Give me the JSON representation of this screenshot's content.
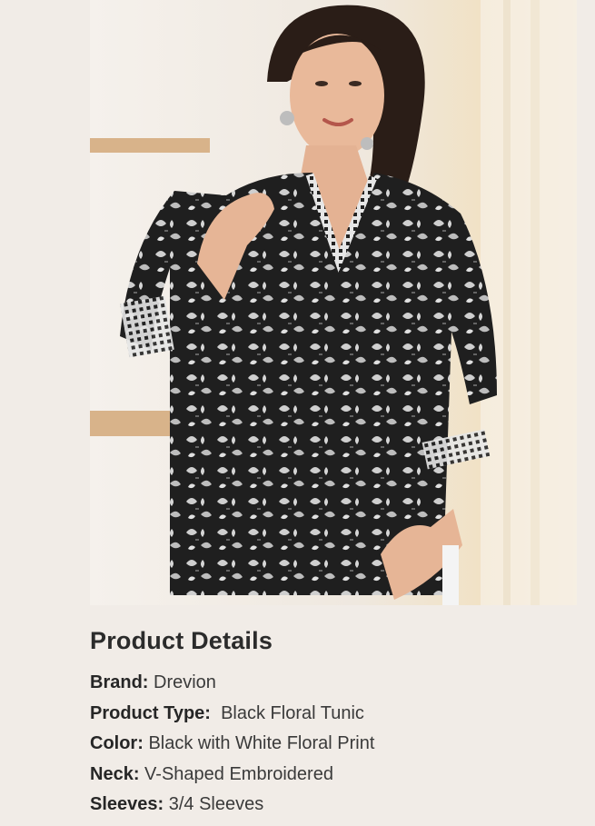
{
  "product_image": {
    "icon": "woman-in-black-floral-tunic-photo"
  },
  "details": {
    "title": "Product Details",
    "rows": [
      {
        "key": "Brand:",
        "value": "Drevion"
      },
      {
        "key": "Product Type:",
        "value": "Black Floral Tunic"
      },
      {
        "key": "Color:",
        "value": "Black with White Floral Print"
      },
      {
        "key": "Neck:",
        "value": "V-Shaped Embroidered"
      },
      {
        "key": "Sleeves:",
        "value": "3/4 Sleeves"
      }
    ]
  },
  "colors": {
    "page_background": "#f1ece7",
    "text": "#2e2e2e",
    "tunic": "#222222",
    "print": "#d9d9d9"
  }
}
